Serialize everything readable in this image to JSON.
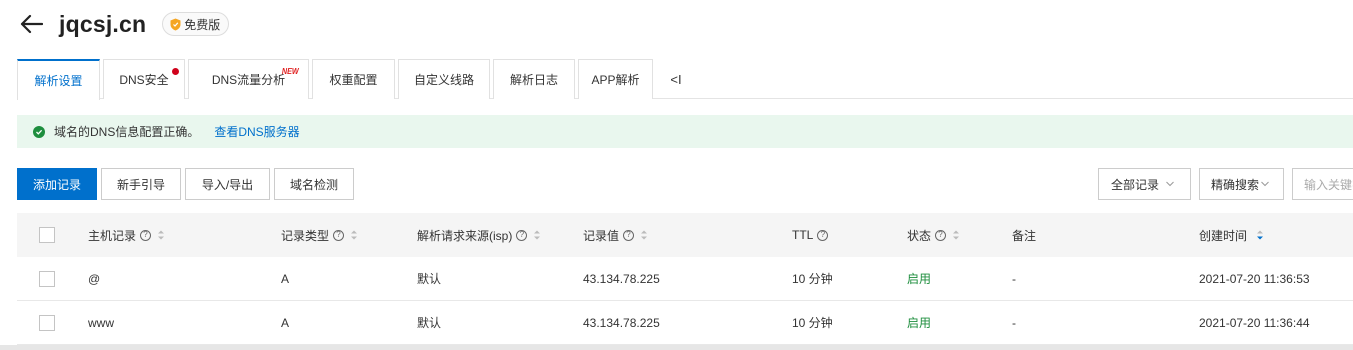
{
  "header": {
    "domain": "jqcsj.cn",
    "badge": "免费版"
  },
  "tabs": [
    {
      "label": "解析设置",
      "active": true
    },
    {
      "label": "DNS安全",
      "dot": true
    },
    {
      "label": "DNS流量分析",
      "new_label": "NEW"
    },
    {
      "label": "权重配置"
    },
    {
      "label": "自定义线路"
    },
    {
      "label": "解析日志"
    },
    {
      "label": "APP解析"
    }
  ],
  "tabs_more": "<I",
  "notice": {
    "text": "域名的DNS信息配置正确。",
    "link": "查看DNS服务器"
  },
  "toolbar": {
    "add": "添加记录",
    "guide": "新手引导",
    "import_export": "导入/导出",
    "check": "域名检测",
    "filter": "全部记录",
    "search_mode": "精确搜索",
    "search_placeholder": "输入关键字"
  },
  "table": {
    "columns": {
      "host": "主机记录",
      "type": "记录类型",
      "isp": "解析请求来源(isp)",
      "value": "记录值",
      "ttl": "TTL",
      "status": "状态",
      "remark": "备注",
      "created": "创建时间"
    },
    "rows": [
      {
        "host": "@",
        "type": "A",
        "isp": "默认",
        "value": "43.134.78.225",
        "ttl": "10 分钟",
        "status": "启用",
        "remark": "-",
        "created": "2021-07-20 11:36:53"
      },
      {
        "host": "www",
        "type": "A",
        "isp": "默认",
        "value": "43.134.78.225",
        "ttl": "10 分钟",
        "status": "启用",
        "remark": "-",
        "created": "2021-07-20 11:36:44"
      }
    ]
  },
  "colors": {
    "primary": "#0070cc",
    "success": "#1e8e3e",
    "notice_bg": "#e9f7ee",
    "badge_orange": "#f5a623"
  }
}
